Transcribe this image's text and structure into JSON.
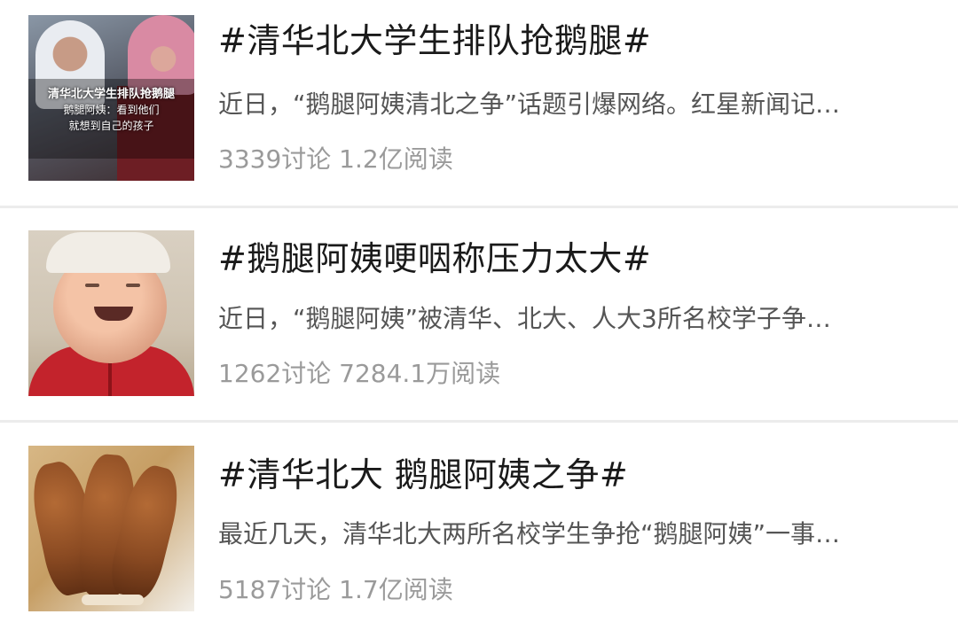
{
  "topics": [
    {
      "title": "#清华北大学生排队抢鹅腿#",
      "summary": "近日，“鹅腿阿姨清北之争”话题引爆网络。红星新闻记…",
      "stats": "3339讨论 1.2亿阅读",
      "thumbnail": {
        "icon": "news-video-still-image",
        "caption_line1": "清华北大学生排队抢鹅腿",
        "caption_line2": "鹅腿阿姨：看到他们",
        "caption_line3": "就想到自己的孩子"
      }
    },
    {
      "title": "#鹅腿阿姨哽咽称压力太大#",
      "summary": "近日，“鹅腿阿姨”被清华、北大、人大3所名校学子争…",
      "stats": "1262讨论 7284.1万阅读",
      "thumbnail": {
        "icon": "portrait-photo-image"
      }
    },
    {
      "title": "#清华北大 鹅腿阿姨之争#",
      "summary": "最近几天，清华北大两所名校学生争抢“鹅腿阿姨”一事…",
      "stats": "5187讨论 1.7亿阅读",
      "thumbnail": {
        "icon": "fried-goose-leg-photo-image"
      }
    }
  ],
  "colors": {
    "title": "#1a1a1a",
    "summary": "#555555",
    "stats": "#9a9a9a",
    "divider": "#ececec",
    "background": "#ffffff"
  }
}
